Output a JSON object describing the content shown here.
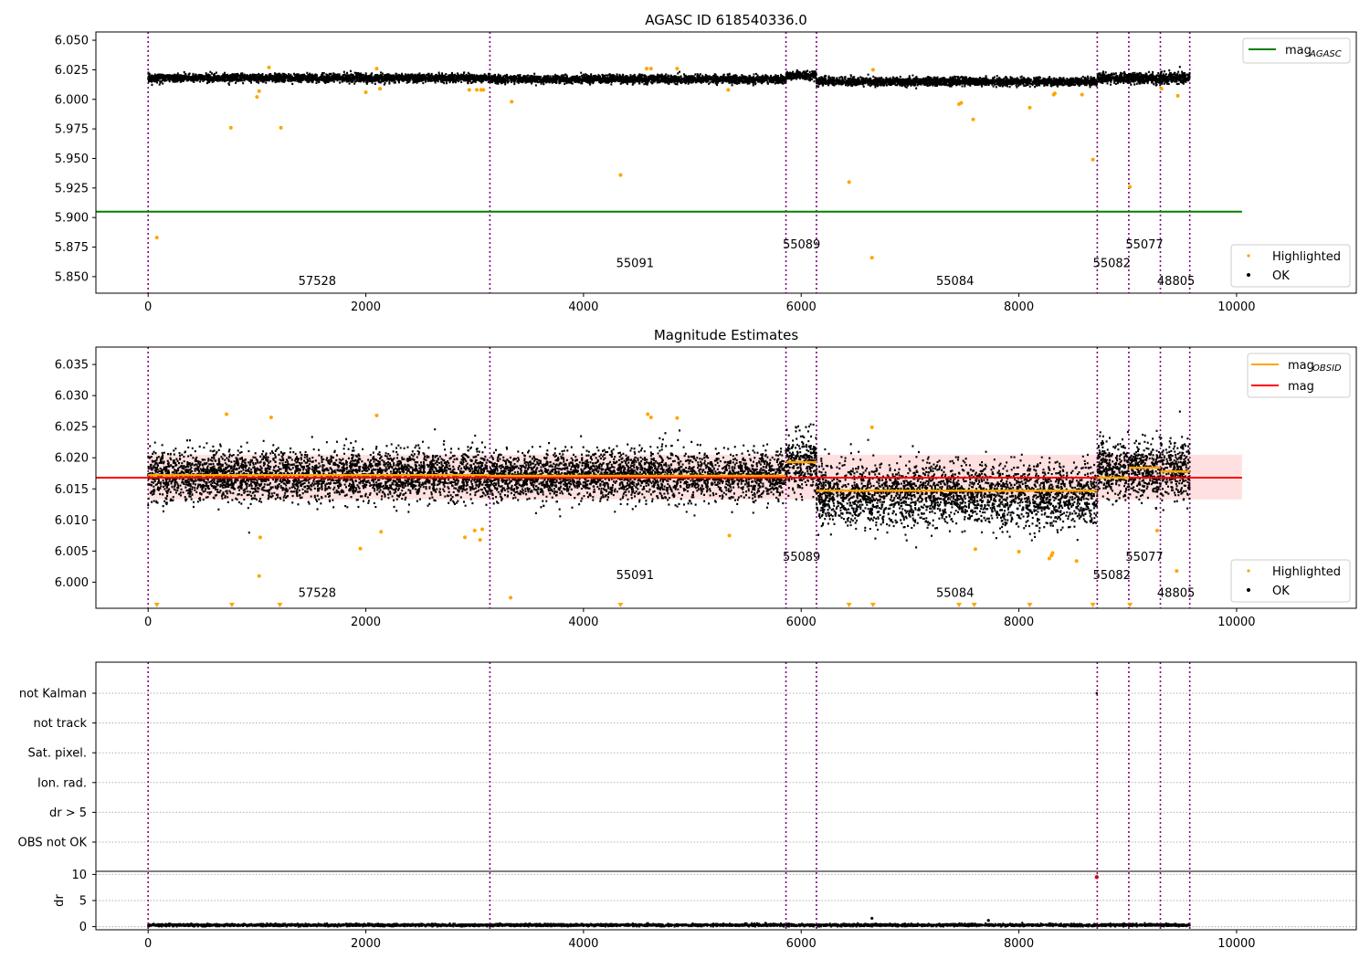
{
  "chart_data": [
    {
      "type": "scatter",
      "title": "AGASC ID 618540336.0",
      "xlim": [
        -480,
        11100
      ],
      "ylim": [
        5.836,
        6.057
      ],
      "xticks": [
        "0",
        "2000",
        "4000",
        "6000",
        "8000",
        "10000"
      ],
      "xtick_values": [
        0,
        2000,
        4000,
        6000,
        8000,
        10000
      ],
      "yticks": [
        "5.850",
        "5.875",
        "5.900",
        "5.925",
        "5.950",
        "5.975",
        "6.000",
        "6.025",
        "6.050"
      ],
      "ytick_values": [
        5.85,
        5.875,
        5.9,
        5.925,
        5.95,
        5.975,
        6.0,
        6.025,
        6.05
      ],
      "legend_top": [
        {
          "label": "mag",
          "sub": "AGASC",
          "color": "#008000"
        }
      ],
      "legend_bottom": [
        {
          "label": "Highlighted",
          "color": "#ffa500"
        },
        {
          "label": "OK",
          "color": "#000000"
        }
      ],
      "agasc_line": {
        "y": 5.905,
        "x_start": -480,
        "x_end": 10050
      },
      "ok_band": [
        {
          "x0": 0,
          "x1": 3140,
          "center": 6.018,
          "spread": 0.003
        },
        {
          "x0": 3140,
          "x1": 5860,
          "center": 6.017,
          "spread": 0.003
        },
        {
          "x0": 5860,
          "x1": 6140,
          "center": 6.02,
          "spread": 0.003
        },
        {
          "x0": 6140,
          "x1": 8720,
          "center": 6.015,
          "spread": 0.003
        },
        {
          "x0": 8720,
          "x1": 9570,
          "center": 6.018,
          "spread": 0.004
        }
      ],
      "highlighted": [
        [
          80,
          5.883
        ],
        [
          760,
          5.976
        ],
        [
          1000,
          6.002
        ],
        [
          1020,
          6.007
        ],
        [
          1110,
          6.027
        ],
        [
          1220,
          5.976
        ],
        [
          2000,
          6.006
        ],
        [
          2100,
          6.026
        ],
        [
          2130,
          6.009
        ],
        [
          2950,
          6.008
        ],
        [
          3020,
          6.008
        ],
        [
          3060,
          6.008
        ],
        [
          3080,
          6.008
        ],
        [
          3340,
          5.998
        ],
        [
          4340,
          5.936
        ],
        [
          4580,
          6.026
        ],
        [
          4620,
          6.026
        ],
        [
          4860,
          6.026
        ],
        [
          5330,
          6.008
        ],
        [
          6440,
          5.93
        ],
        [
          6650,
          5.866
        ],
        [
          6660,
          6.025
        ],
        [
          7450,
          5.996
        ],
        [
          7470,
          5.997
        ],
        [
          7580,
          5.983
        ],
        [
          8100,
          5.993
        ],
        [
          8320,
          6.004
        ],
        [
          8330,
          6.005
        ],
        [
          8580,
          6.004
        ],
        [
          8680,
          5.949
        ],
        [
          9020,
          5.926
        ],
        [
          9310,
          6.009
        ],
        [
          9460,
          6.003
        ]
      ],
      "vlines": [
        0,
        3140,
        5860,
        6140,
        8720,
        9010,
        9300,
        9570
      ],
      "obsid_labels": [
        {
          "text": "57528",
          "x": 1380,
          "y": 5.843
        },
        {
          "text": "55091",
          "x": 4300,
          "y": 5.858
        },
        {
          "text": "55089",
          "x": 5830,
          "y": 5.874
        },
        {
          "text": "55084",
          "x": 7240,
          "y": 5.843
        },
        {
          "text": "55082",
          "x": 8680,
          "y": 5.858
        },
        {
          "text": "55077",
          "x": 8980,
          "y": 5.874
        },
        {
          "text": "48805",
          "x": 9270,
          "y": 5.843
        }
      ]
    },
    {
      "type": "scatter",
      "title": "Magnitude Estimates",
      "xlim": [
        -480,
        11100
      ],
      "ylim": [
        5.9958,
        6.0378
      ],
      "xticks": [
        "0",
        "2000",
        "4000",
        "6000",
        "8000",
        "10000"
      ],
      "xtick_values": [
        0,
        2000,
        4000,
        6000,
        8000,
        10000
      ],
      "yticks": [
        "6.000",
        "6.005",
        "6.010",
        "6.015",
        "6.020",
        "6.025",
        "6.030",
        "6.035"
      ],
      "ytick_values": [
        6.0,
        6.005,
        6.01,
        6.015,
        6.02,
        6.025,
        6.03,
        6.035
      ],
      "legend_top": [
        {
          "label": "mag",
          "sub": "OBSID",
          "color": "#ffa500"
        },
        {
          "label": "mag",
          "sub": "",
          "color": "#ff0000"
        }
      ],
      "legend_bottom": [
        {
          "label": "Highlighted",
          "color": "#ffa500"
        },
        {
          "label": "OK",
          "color": "#000000"
        }
      ],
      "mag": {
        "value": 6.0168,
        "band": [
          6.0133,
          6.0205
        ],
        "x_start": -480,
        "x_end": 10050
      },
      "mag_obsid": [
        {
          "x0": 0,
          "x1": 3140,
          "y": 6.0172
        },
        {
          "x0": 3140,
          "x1": 5860,
          "y": 6.0171
        },
        {
          "x0": 5860,
          "x1": 6140,
          "y": 6.0193
        },
        {
          "x0": 6140,
          "x1": 8720,
          "y": 6.0147
        },
        {
          "x0": 8720,
          "x1": 9010,
          "y": 6.0168
        },
        {
          "x0": 9010,
          "x1": 9300,
          "y": 6.0184
        },
        {
          "x0": 9300,
          "x1": 9570,
          "y": 6.0178
        }
      ],
      "ok_band": [
        {
          "x0": 0,
          "x1": 3140,
          "center": 6.0172,
          "spread": 0.0035
        },
        {
          "x0": 3140,
          "x1": 5860,
          "center": 6.0171,
          "spread": 0.0035
        },
        {
          "x0": 5860,
          "x1": 6140,
          "center": 6.0193,
          "spread": 0.004
        },
        {
          "x0": 6140,
          "x1": 8720,
          "center": 6.014,
          "spread": 0.0045
        },
        {
          "x0": 8720,
          "x1": 9570,
          "center": 6.018,
          "spread": 0.004
        }
      ],
      "highlighted": [
        [
          720,
          6.027
        ],
        [
          1020,
          6.001
        ],
        [
          1030,
          6.0072
        ],
        [
          1130,
          6.0265
        ],
        [
          1950,
          6.0054
        ],
        [
          2100,
          6.0268
        ],
        [
          2140,
          6.0081
        ],
        [
          2910,
          6.0072
        ],
        [
          3000,
          6.0083
        ],
        [
          3050,
          6.0068
        ],
        [
          3070,
          6.0085
        ],
        [
          3330,
          5.9975
        ],
        [
          4590,
          6.027
        ],
        [
          4620,
          6.0265
        ],
        [
          4860,
          6.0264
        ],
        [
          5340,
          6.0075
        ],
        [
          6650,
          6.0249
        ],
        [
          7600,
          6.0053
        ],
        [
          8000,
          6.0049
        ],
        [
          8280,
          6.0038
        ],
        [
          8300,
          6.0043
        ],
        [
          8310,
          6.0047
        ],
        [
          8530,
          6.0034
        ],
        [
          9270,
          6.0083
        ],
        [
          9450,
          6.0018
        ]
      ],
      "down_markers": [
        80,
        770,
        1210,
        4340,
        6440,
        6660,
        7450,
        7590,
        8100,
        8680,
        9020
      ],
      "vlines": [
        0,
        3140,
        5860,
        6140,
        8720,
        9010,
        9300,
        9570
      ],
      "obsid_labels": [
        {
          "text": "57528",
          "x": 1380,
          "y": 5.9976
        },
        {
          "text": "55091",
          "x": 4300,
          "y": 6.0005
        },
        {
          "text": "55089",
          "x": 5830,
          "y": 6.0034
        },
        {
          "text": "55084",
          "x": 7240,
          "y": 5.9976
        },
        {
          "text": "55082",
          "x": 8680,
          "y": 6.0005
        },
        {
          "text": "55077",
          "x": 8980,
          "y": 6.0034
        },
        {
          "text": "48805",
          "x": 9270,
          "y": 5.9976
        }
      ]
    },
    {
      "type": "scatter",
      "title": "",
      "xlim": [
        -480,
        11100
      ],
      "xticks": [
        "0",
        "2000",
        "4000",
        "6000",
        "8000",
        "10000"
      ],
      "xtick_values": [
        0,
        2000,
        4000,
        6000,
        8000,
        10000
      ],
      "flag_labels": [
        "not Kalman",
        "not track",
        "Sat. pixel.",
        "Ion. rad.",
        "dr > 5",
        "OBS not OK"
      ],
      "flag_points": [
        {
          "row": "not Kalman",
          "x": 8715
        }
      ],
      "dr": {
        "ylabel": "dr",
        "ylim": [
          -0.6,
          10.6
        ],
        "yticks": [
          "0",
          "5",
          "10"
        ],
        "ytick_values": [
          0,
          5,
          10
        ],
        "x_range": [
          0,
          9570
        ],
        "typical": 0.3,
        "outliers": [
          [
            6650,
            1.6
          ],
          [
            7720,
            1.2
          ],
          [
            8715,
            9.5
          ]
        ]
      },
      "vlines": [
        0,
        3140,
        5860,
        6140,
        8720,
        9010,
        9300,
        9570
      ]
    }
  ]
}
